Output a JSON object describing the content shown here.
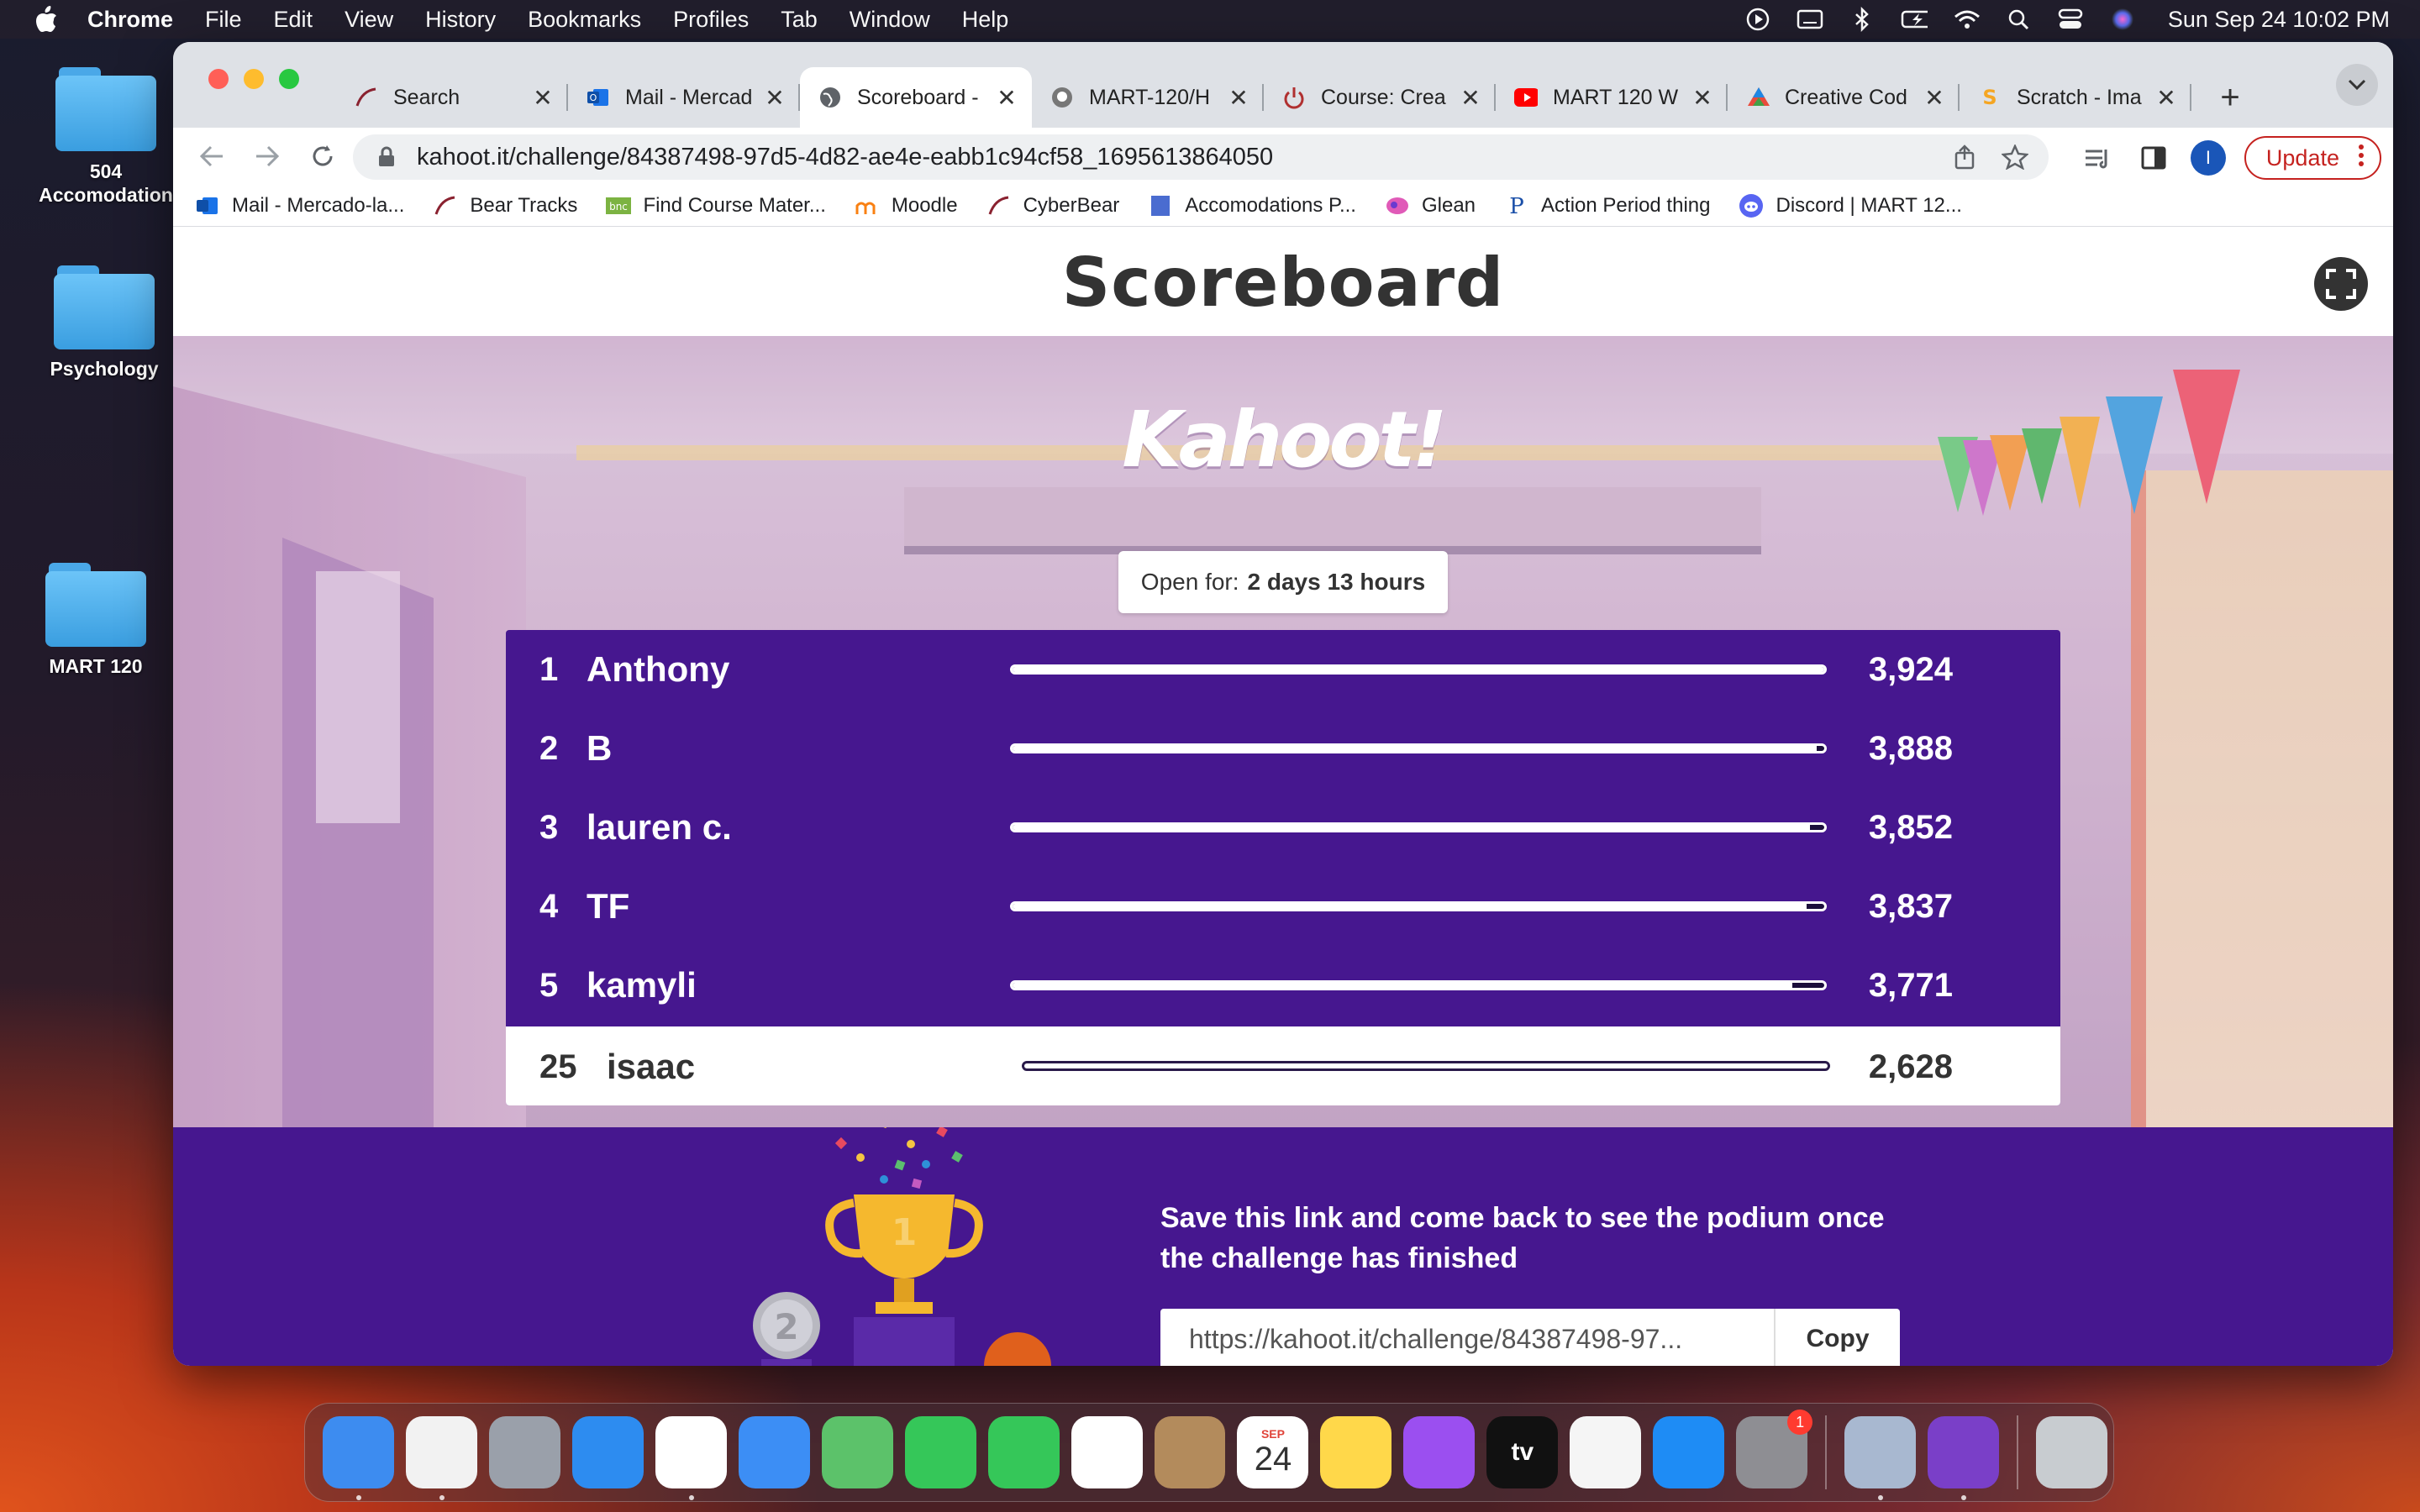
{
  "menubar": {
    "app_name": "Chrome",
    "items": [
      "File",
      "Edit",
      "View",
      "History",
      "Bookmarks",
      "Profiles",
      "Tab",
      "Window",
      "Help"
    ],
    "clock": "Sun Sep 24  10:02 PM"
  },
  "desktop": {
    "icons": [
      {
        "label": "504 Accomodation"
      },
      {
        "label": "Psychology"
      },
      {
        "label": "MART 120"
      }
    ]
  },
  "browser": {
    "tabs": [
      {
        "title": "Search",
        "icon": "bear-tracks-icon"
      },
      {
        "title": "Mail - Mercad",
        "icon": "outlook-icon"
      },
      {
        "title": "Scoreboard -",
        "icon": "globe-icon",
        "active": true
      },
      {
        "title": "MART-120/H",
        "icon": "github-icon"
      },
      {
        "title": "Course: Crea",
        "icon": "power-icon"
      },
      {
        "title": "MART 120 W",
        "icon": "youtube-icon"
      },
      {
        "title": "Creative Cod",
        "icon": "creative-icon"
      },
      {
        "title": "Scratch - Ima",
        "icon": "scratch-icon"
      }
    ],
    "url": "kahoot.it/challenge/84387498-97d5-4d82-ae4e-eabb1c94cf58_1695613864050",
    "profile_initial": "I",
    "update_label": "Update",
    "bookmarks": [
      {
        "label": "Mail - Mercado-la...",
        "icon": "outlook-icon"
      },
      {
        "label": "Bear Tracks",
        "icon": "bear-tracks-icon"
      },
      {
        "label": "Find Course Mater...",
        "icon": "bnc-icon"
      },
      {
        "label": "Moodle",
        "icon": "moodle-icon"
      },
      {
        "label": "CyberBear",
        "icon": "bear-tracks-icon"
      },
      {
        "label": "Accomodations P...",
        "icon": "document-icon"
      },
      {
        "label": "Glean",
        "icon": "glean-icon"
      },
      {
        "label": "Action Period thing",
        "icon": "p-icon"
      },
      {
        "label": "Discord | MART 12...",
        "icon": "discord-icon"
      }
    ]
  },
  "page": {
    "title": "Scoreboard",
    "logo_text": "Kahoot!",
    "open_for_label": "Open for:",
    "open_for_value": "2 days 13 hours",
    "scores": [
      {
        "rank": "1",
        "name": "Anthony",
        "score": "3,924",
        "fill": 1.0
      },
      {
        "rank": "2",
        "name": "B",
        "score": "3,888",
        "fill": 0.991
      },
      {
        "rank": "3",
        "name": "lauren c.",
        "score": "3,852",
        "fill": 0.982
      },
      {
        "rank": "4",
        "name": "TF",
        "score": "3,837",
        "fill": 0.978
      },
      {
        "rank": "5",
        "name": "kamyli",
        "score": "3,771",
        "fill": 0.961
      }
    ],
    "me": {
      "rank": "25",
      "name": "isaac",
      "score": "2,628",
      "fill": 0.0
    },
    "save_message": "Save this link and come back to see the podium once the challenge has finished",
    "share_link": "https://kahoot.it/challenge/84387498-97...",
    "copy_label": "Copy"
  },
  "dock": {
    "apps": [
      {
        "name": "finder-icon",
        "color": "#3d8cf0",
        "running": true
      },
      {
        "name": "textedit-icon",
        "color": "#f2f2f2",
        "running": true
      },
      {
        "name": "launchpad-icon",
        "color": "#9aa0aa",
        "running": false
      },
      {
        "name": "safari-icon",
        "color": "#2d8cf0",
        "running": false
      },
      {
        "name": "chrome-icon",
        "color": "#ffffff",
        "running": true
      },
      {
        "name": "mail-icon",
        "color": "#3c8ef5",
        "running": false
      },
      {
        "name": "maps-icon",
        "color": "#5cc26a",
        "running": false
      },
      {
        "name": "facetime-icon",
        "color": "#35c759",
        "running": false
      },
      {
        "name": "messages-icon",
        "color": "#35c759",
        "running": false
      },
      {
        "name": "photos-icon",
        "color": "#ffffff",
        "running": false
      },
      {
        "name": "contacts-icon",
        "color": "#b38b5c",
        "running": false
      },
      {
        "name": "calendar-icon",
        "color": "#ffffff",
        "running": false,
        "month": "SEP",
        "day": "24"
      },
      {
        "name": "notes-icon",
        "color": "#ffd84a",
        "running": false
      },
      {
        "name": "podcasts-icon",
        "color": "#9b4ff0",
        "running": false
      },
      {
        "name": "appletv-icon",
        "color": "#111111",
        "running": false,
        "label": "tv"
      },
      {
        "name": "news-icon",
        "color": "#f5f5f5",
        "running": false
      },
      {
        "name": "appstore-icon",
        "color": "#1e8cf5",
        "running": false
      },
      {
        "name": "system-settings-icon",
        "color": "#8e8e93",
        "running": false,
        "badge": "1"
      }
    ],
    "recent": [
      {
        "name": "preview-icon",
        "color": "#a8b8d0",
        "running": true
      },
      {
        "name": "github-desktop-icon",
        "color": "#7a3fc8",
        "running": true
      }
    ],
    "trash": {
      "name": "trash-icon",
      "color": "#c8ccd0"
    }
  }
}
